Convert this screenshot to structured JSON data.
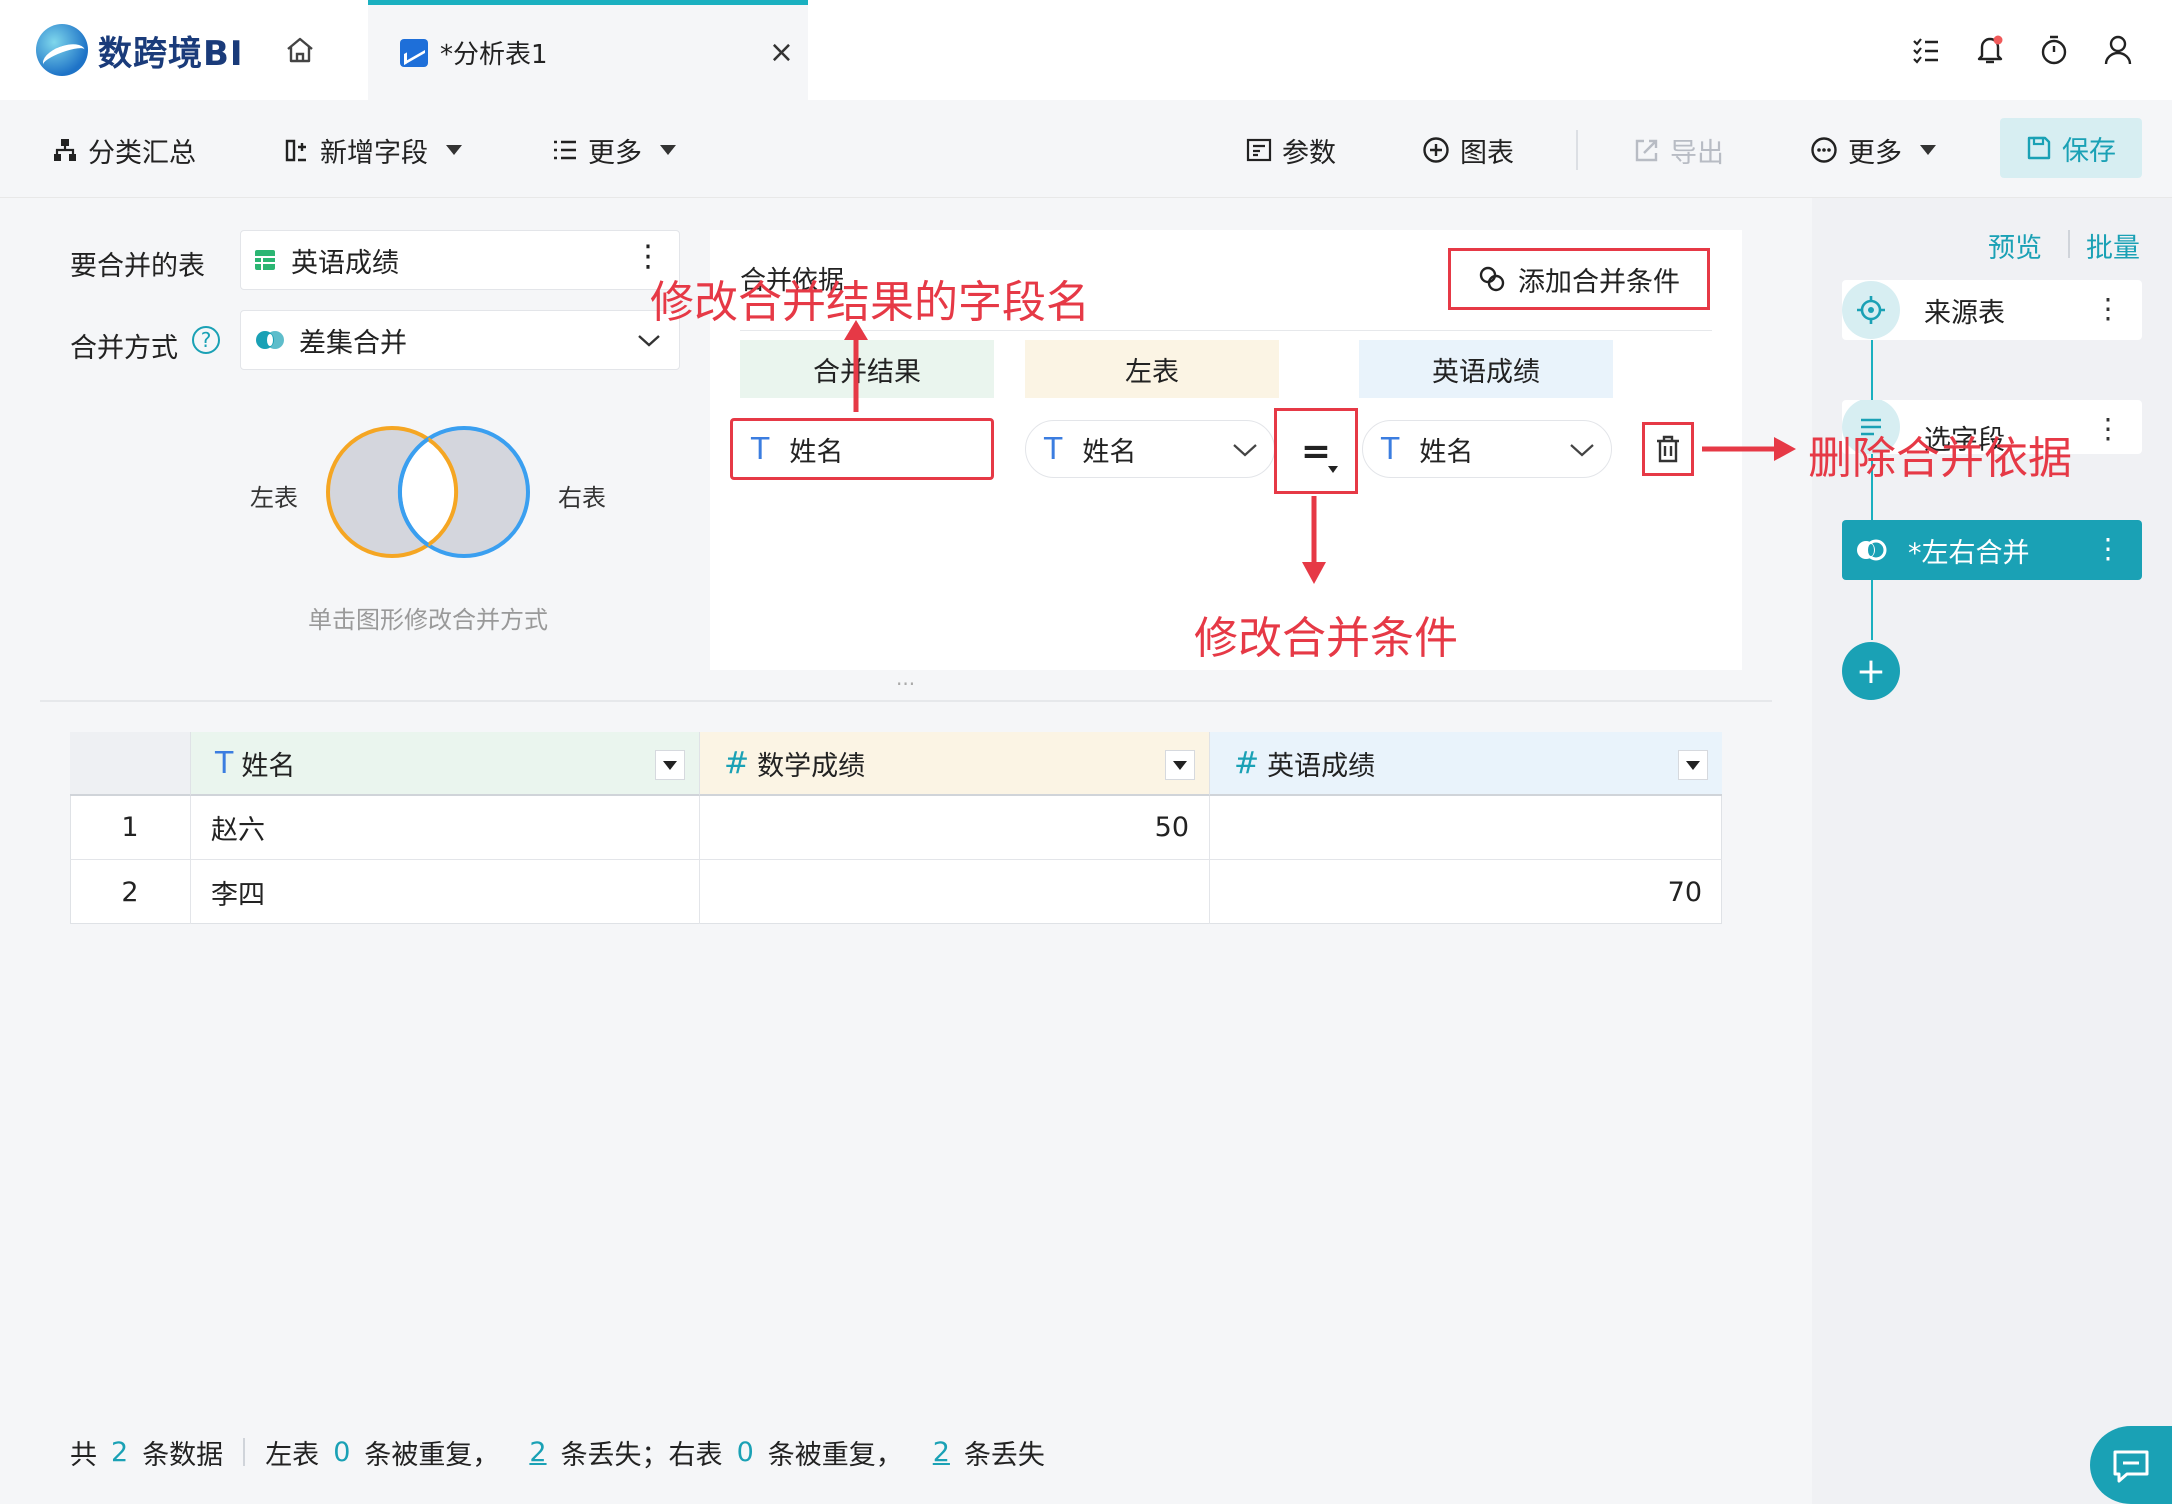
{
  "app": {
    "logo_text": "数跨境BI"
  },
  "tabs": {
    "doc_tab_label": "*分析表1",
    "close_glyph": "×"
  },
  "toolbar": {
    "group_summary": "分类汇总",
    "add_field": "新增字段",
    "more_left": "更多",
    "params": "参数",
    "chart": "图表",
    "export": "导出",
    "more_right": "更多",
    "save": "保存"
  },
  "right_panel": {
    "preview": "预览",
    "batch": "批量",
    "nodes": [
      {
        "label": "来源表"
      },
      {
        "label": "选字段"
      },
      {
        "label": "*左右合并"
      }
    ],
    "add_glyph": "+"
  },
  "merge_settings": {
    "table_label": "要合并的表",
    "table_value": "英语成绩",
    "method_label": "合并方式",
    "method_value": "差集合并",
    "venn_left": "左表",
    "venn_right": "右表",
    "venn_hint": "单击图形修改合并方式"
  },
  "conditions": {
    "title": "合并依据",
    "add_condition": "添加合并条件",
    "col_result": "合并结果",
    "col_left": "左表",
    "col_right": "英语成绩",
    "result_field": "姓名",
    "left_field": "姓名",
    "operator": "=",
    "right_field": "姓名",
    "type_glyph": "T"
  },
  "annotations": {
    "rename": "修改合并结果的字段名",
    "condition": "修改合并条件",
    "delete": "删除合并依据"
  },
  "splitter": "···",
  "table": {
    "columns": [
      {
        "type": "T",
        "name": "姓名",
        "bg": "#eaf5ee"
      },
      {
        "type": "#",
        "name": "数学成绩",
        "bg": "#fbf4e4"
      },
      {
        "type": "#",
        "name": "英语成绩",
        "bg": "#e9f3fb"
      }
    ],
    "rows": [
      {
        "index": "1",
        "cells": [
          "赵六",
          "50",
          ""
        ]
      },
      {
        "index": "2",
        "cells": [
          "李四",
          "",
          "70"
        ]
      }
    ]
  },
  "status": {
    "total_prefix": "共",
    "total": "2",
    "total_suffix": "条数据",
    "left_label": "左表",
    "left_dup": "0",
    "dup_text": "条被重复，",
    "left_lost": "2",
    "left_lost_text": "条丢失；右表",
    "right_dup": "0",
    "right_dup_text": "条被重复，",
    "right_lost": "2",
    "right_lost_text": "条丢失"
  },
  "colors": {
    "accent": "#1aa1b5",
    "annotation": "#e63946",
    "venn_left": "#f5a623",
    "venn_right": "#3a9ff0"
  }
}
